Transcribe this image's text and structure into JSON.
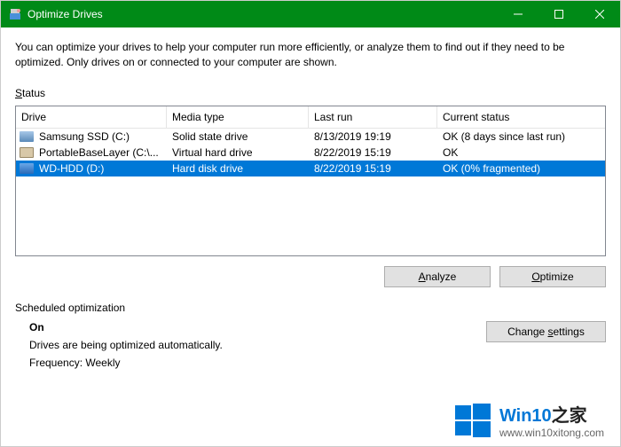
{
  "window": {
    "title": "Optimize Drives",
    "intro": "You can optimize your drives to help your computer run more efficiently, or analyze them to find out if they need to be optimized. Only drives on or connected to your computer are shown.",
    "status_label_pre": "S",
    "status_label_post": "tatus"
  },
  "columns": {
    "drive": "Drive",
    "media": "Media type",
    "last": "Last run",
    "status": "Current status"
  },
  "drives": [
    {
      "name": "Samsung SSD (C:)",
      "media": "Solid state drive",
      "last": "8/13/2019 19:19",
      "status": "OK (8 days since last run)"
    },
    {
      "name": "PortableBaseLayer (C:\\...",
      "media": "Virtual hard drive",
      "last": "8/22/2019 15:19",
      "status": "OK"
    },
    {
      "name": "WD-HDD (D:)",
      "media": "Hard disk drive",
      "last": "8/22/2019 15:19",
      "status": "OK (0% fragmented)"
    }
  ],
  "buttons": {
    "analyze_pre": "",
    "analyze_u": "A",
    "analyze_post": "nalyze",
    "optimize_pre": "",
    "optimize_u": "O",
    "optimize_post": "ptimize",
    "change_pre": "Change ",
    "change_u": "s",
    "change_post": "ettings"
  },
  "sched": {
    "label": "Scheduled optimization",
    "on": "On",
    "desc": "Drives are being optimized automatically.",
    "freq": "Frequency: Weekly"
  },
  "watermark": {
    "brand_a": "Win10",
    "brand_b": "之家",
    "url": "www.win10xitong.com"
  }
}
